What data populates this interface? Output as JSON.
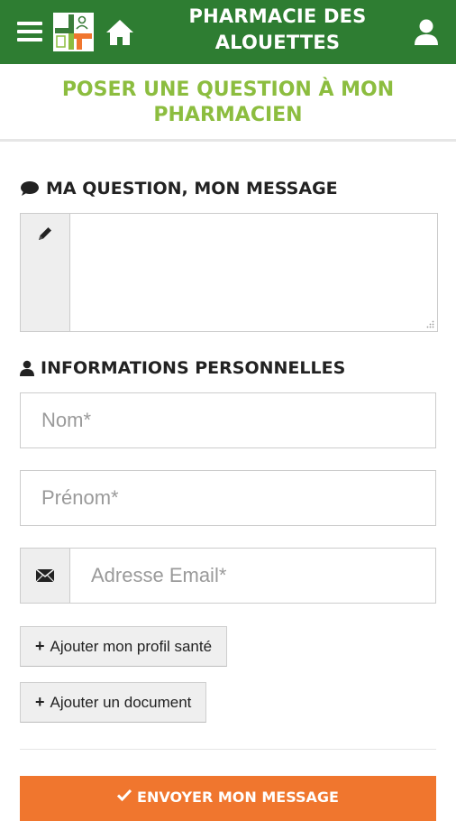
{
  "header": {
    "title": "PHARMACIE DES ALOUETTES",
    "menu_icon": "hamburger-icon",
    "logo_icon": "pharmacy-cross-logo",
    "home_icon": "home-icon",
    "user_icon": "user-icon",
    "background_color": "#2e7d32"
  },
  "page": {
    "title": "POSER UNE QUESTION À MON PHARMACIEN",
    "title_color": "#8cbd3f"
  },
  "message_section": {
    "heading": "MA QUESTION, MON MESSAGE",
    "heading_icon": "speech-bubble-icon",
    "textarea_icon": "pencil-icon",
    "textarea_value": ""
  },
  "personal_section": {
    "heading": "INFORMATIONS PERSONNELLES",
    "heading_icon": "user-icon",
    "nom_placeholder": "Nom*",
    "prenom_placeholder": "Prénom*",
    "email_placeholder": "Adresse Email*",
    "email_icon": "envelope-icon"
  },
  "actions": {
    "add_health_profile": "Ajouter mon profil santé",
    "add_document": "Ajouter un document",
    "submit": "ENVOYER MON MESSAGE",
    "submit_color": "#f0762e"
  }
}
